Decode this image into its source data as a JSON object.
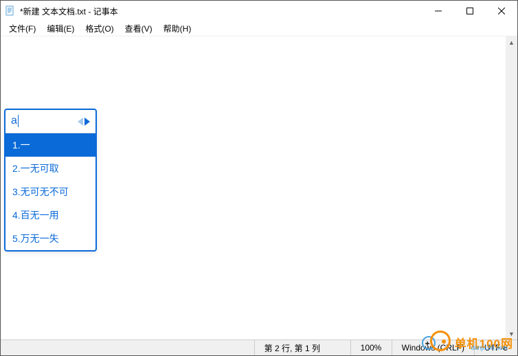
{
  "titlebar": {
    "title": "*新建 文本文档.txt - 记事本"
  },
  "menubar": {
    "items": [
      "文件(F)",
      "编辑(E)",
      "格式(O)",
      "查看(V)",
      "帮助(H)"
    ]
  },
  "editor": {
    "content": ""
  },
  "ime": {
    "input": "a",
    "candidates": [
      {
        "label": "1.一",
        "selected": true
      },
      {
        "label": "2.一无可取",
        "selected": false
      },
      {
        "label": "3.无可无不可",
        "selected": false
      },
      {
        "label": "4.百无一用",
        "selected": false
      },
      {
        "label": "5.万无一失",
        "selected": false
      }
    ]
  },
  "statusbar": {
    "position": "第 2 行, 第 1 列",
    "zoom": "100%",
    "line_ending": "Windows (CRLF)",
    "encoding": "UTF-8"
  },
  "watermark": {
    "text": "单机100网",
    "sub": "danji100.com"
  }
}
